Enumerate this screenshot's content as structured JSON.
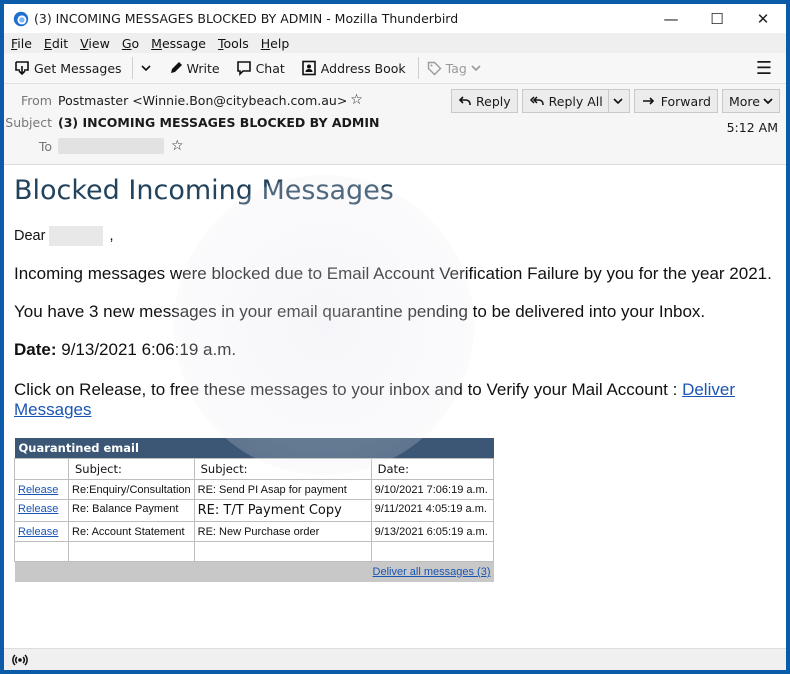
{
  "window": {
    "title": "(3) INCOMING MESSAGES BLOCKED BY ADMIN - Mozilla Thunderbird",
    "controls": {
      "minimize": "—",
      "maximize": "☐",
      "close": "✕"
    }
  },
  "menu": {
    "items": [
      {
        "key": "F",
        "rest": "ile"
      },
      {
        "key": "E",
        "rest": "dit"
      },
      {
        "key": "V",
        "rest": "iew"
      },
      {
        "key": "G",
        "rest": "o"
      },
      {
        "key": "M",
        "rest": "essage"
      },
      {
        "key": "T",
        "rest": "ools"
      },
      {
        "key": "H",
        "rest": "elp"
      }
    ]
  },
  "toolbar": {
    "get_messages": "Get Messages",
    "write": "Write",
    "chat": "Chat",
    "address_book": "Address Book",
    "tag": "Tag",
    "menu_icon": "☰"
  },
  "header": {
    "from_label": "From",
    "from_value": "Postmaster <Winnie.Bon@citybeach.com.au>",
    "subject_label": "Subject",
    "subject_value": "(3) INCOMING MESSAGES BLOCKED BY ADMIN",
    "to_label": "To",
    "time": "5:12 AM",
    "actions": {
      "reply": "Reply",
      "reply_all": "Reply All",
      "forward": "Forward",
      "more": "More"
    }
  },
  "message": {
    "heading": "Blocked Incoming Messages",
    "dear": "Dear",
    "dear_comma": ",",
    "para1": "Incoming messages were blocked due to Email Account Verification Failure by you for the year 2021.",
    "para2": "You have 3 new messages in your email quarantine pending to be delivered into your Inbox.",
    "date_label": "Date:",
    "date_value": " 9/13/2021 6:06:19 a.m.",
    "para4": "Click on Release, to free these messages to your inbox and to Verify your Mail Account : ",
    "deliver_link": "Deliver Messages",
    "table": {
      "title": "Quarantined email",
      "headers": [
        "",
        "Subject:",
        "Subject:",
        "Date:"
      ],
      "rows": [
        {
          "action": "Release",
          "subject1": "Re:Enquiry/Consultation",
          "subject2": "RE: Send PI Asap for payment",
          "date": "9/10/2021 7:06:19 a.m."
        },
        {
          "action": "Release",
          "subject1": "Re: Balance Payment",
          "subject2": "RE: T/T Payment Copy",
          "date": "9/11/2021 4:05:19 a.m."
        },
        {
          "action": "Release",
          "subject1": "Re: Account Statement",
          "subject2": "RE: New Purchase order",
          "date": "9/13/2021 6:05:19 a.m."
        }
      ],
      "footer_link": "Deliver all messages (3)"
    }
  },
  "status": {
    "icon": "online-status-icon"
  }
}
